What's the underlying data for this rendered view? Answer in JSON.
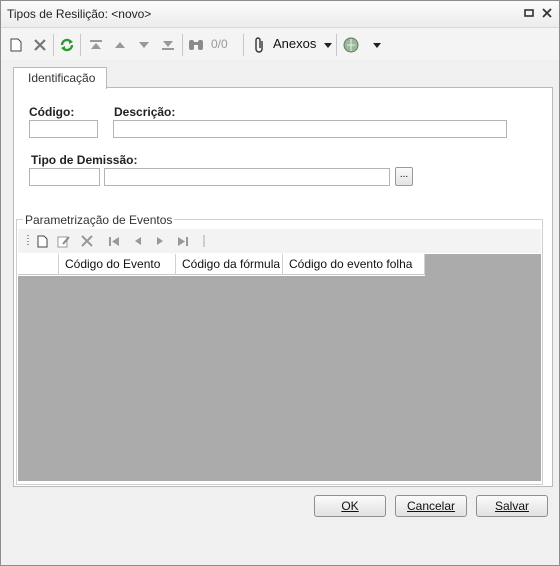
{
  "window": {
    "title": "Tipos de Resilição: <novo>"
  },
  "toolbar": {
    "counter": "0/0",
    "anexos_label": "Anexos"
  },
  "tabs": [
    {
      "label": "Identificação"
    }
  ],
  "form": {
    "codigo_label": "Código:",
    "codigo_value": "",
    "descricao_label": "Descrição:",
    "descricao_value": "",
    "tipo_demissao_label": "Tipo de Demissão:",
    "tipo_demissao_code": "",
    "tipo_demissao_desc": "",
    "lookup_label": "..."
  },
  "eventos": {
    "group_title": "Parametrização de Eventos",
    "columns": [
      "Código do Evento",
      "Código da fórmula",
      "Código do evento folha"
    ],
    "rows": []
  },
  "buttons": {
    "ok": "OK",
    "cancelar": "Cancelar",
    "salvar": "Salvar"
  }
}
